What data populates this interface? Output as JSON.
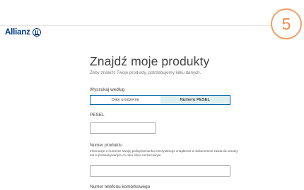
{
  "brand": {
    "name": "Allianz"
  },
  "step": {
    "number": "5",
    "accent_color": "#f39d62"
  },
  "page": {
    "title": "Znajdź moje produkty",
    "subtitle": "Żeby znaleźć Twoje produkty, potrzebujemy kilku danych."
  },
  "search": {
    "label": "Wyszukaj według",
    "options": [
      {
        "label": "Daty urodzenia",
        "selected": false
      },
      {
        "label": "Numeru PESEL",
        "selected": true
      }
    ],
    "active_color": "#dff0f0",
    "border_color": "#0067a6"
  },
  "pesel": {
    "label": "PESEL",
    "value": ""
  },
  "product": {
    "label": "Numer produktu",
    "help": "Informacje o numerze swojej polisy/rachunku emerytalnego znajdziesz w dokumencie zawarcia umowy lub w przekazywanym co roku liście rocznicowym.",
    "value": ""
  },
  "phone": {
    "label": "Numer telefonu komórkowego"
  }
}
